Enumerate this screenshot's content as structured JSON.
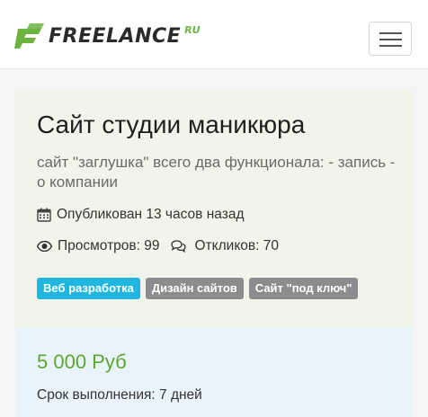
{
  "header": {
    "logo_text": "FREELANCE",
    "logo_suffix": "RU",
    "menu_toggle": "menu"
  },
  "project": {
    "title": "Сайт студии маникюра",
    "description": "сайт \"заглушка\" всего два функционала: - запись - о компании",
    "published": "Опубликован 13 часов назад",
    "views": "Просмотров: 99",
    "replies": "Откликов: 70",
    "tags": [
      "Веб разработка",
      "Дизайн сайтов",
      "Сайт \"под ключ\""
    ]
  },
  "budget": {
    "price": "5 000 Руб",
    "deadline": "Срок выполнения: 7 дней"
  },
  "colors": {
    "brand_green": "#6db33f",
    "tag_primary": "#1fb7e0",
    "tag_muted": "#8c8c8c",
    "card_bg": "#f1f4ea",
    "price_bg": "#e9f3fc",
    "price_color": "#5da630"
  },
  "icons": {
    "published": "calendar-icon",
    "views": "eye-icon",
    "replies": "comments-icon"
  }
}
